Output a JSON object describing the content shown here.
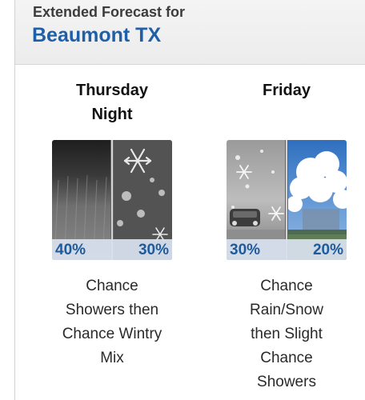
{
  "header": {
    "subtitle": "Extended Forecast for",
    "location": "Beaumont TX"
  },
  "periods": [
    {
      "name_lines": [
        "Thursday",
        "Night"
      ],
      "left_pop": "40%",
      "right_pop": "30%",
      "icon_left": "rain-showers-icon",
      "icon_right": "wintry-mix-icon",
      "desc_lines": [
        "Chance",
        "Showers then",
        "Chance Wintry",
        "Mix"
      ]
    },
    {
      "name_lines": [
        "Friday"
      ],
      "left_pop": "30%",
      "right_pop": "20%",
      "icon_left": "rain-snow-icon",
      "icon_right": "showers-icon",
      "desc_lines": [
        "Chance",
        "Rain/Snow",
        "then Slight",
        "Chance",
        "Showers"
      ]
    }
  ]
}
